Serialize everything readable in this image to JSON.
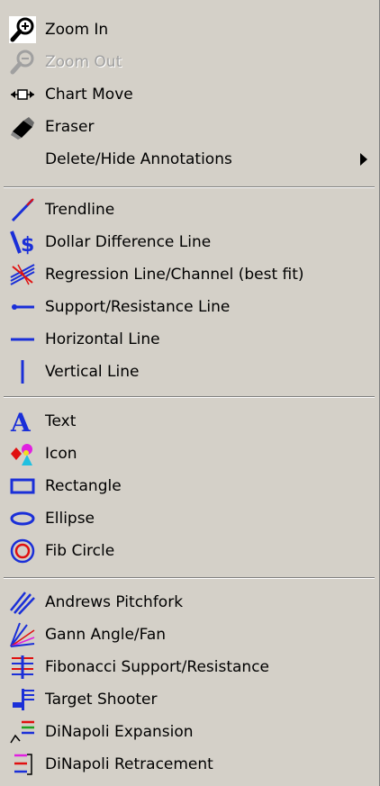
{
  "menu": {
    "zoom_in": "Zoom In",
    "zoom_out": "Zoom Out",
    "chart_move": "Chart Move",
    "eraser": "Eraser",
    "delete_hide": "Delete/Hide Annotations",
    "trendline": "Trendline",
    "dollar_difference": "Dollar Difference Line",
    "regression": "Regression Line/Channel (best fit)",
    "support_resistance": "Support/Resistance Line",
    "horizontal": "Horizontal Line",
    "vertical": "Vertical Line",
    "text": "Text",
    "icon": "Icon",
    "rectangle": "Rectangle",
    "ellipse": "Ellipse",
    "fib_circle": "Fib Circle",
    "andrews": "Andrews Pitchfork",
    "gann": "Gann Angle/Fan",
    "fibonacci": "Fibonacci Support/Resistance",
    "target_shooter": "Target Shooter",
    "dinapoli_expansion": "DiNapoli Expansion",
    "dinapoli_retracement": "DiNapoli Retracement"
  },
  "colors": {
    "menu_bg": "#d4d0c8",
    "accent_blue": "#1a2fd8",
    "disabled_text": "#a0a0a0"
  },
  "state": {
    "zoom_out_disabled": true
  }
}
